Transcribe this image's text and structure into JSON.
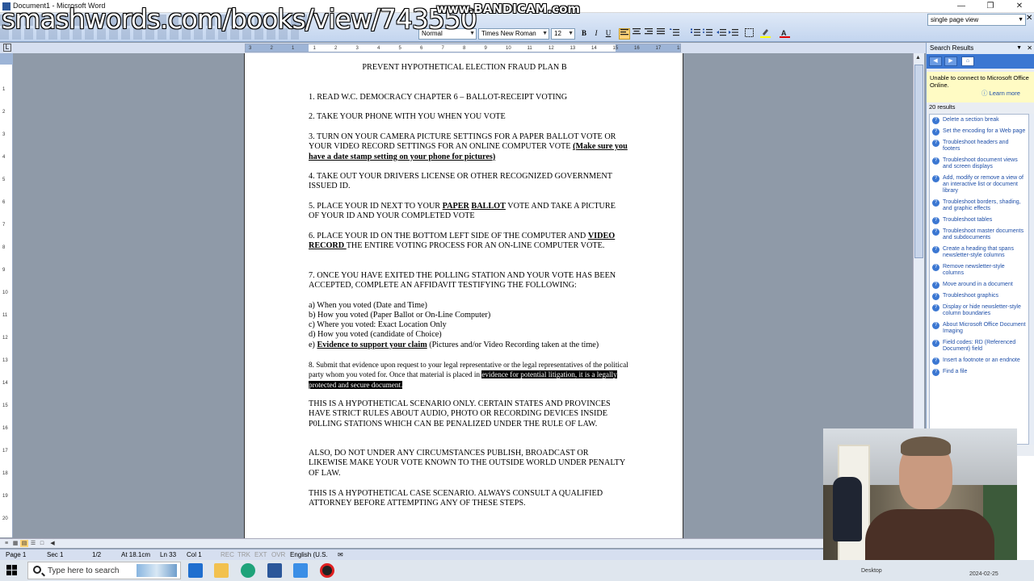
{
  "window": {
    "title": "Document1 - Microsoft Word"
  },
  "overlay": {
    "url_watermark": "smashwords.com/books/view/743550",
    "recorder": "www.BANDICAM.com"
  },
  "toolbar": {
    "style": "Normal",
    "font": "Times New Roman",
    "size": "12",
    "bold": "B",
    "italic": "I",
    "underline": "U",
    "help_box": "single page view"
  },
  "ruler": {
    "ticks": [
      "3",
      "2",
      "1",
      "1",
      "2",
      "3",
      "4",
      "5",
      "6",
      "7",
      "8",
      "9",
      "10",
      "11",
      "12",
      "13",
      "14",
      "15",
      "16",
      "17",
      "18"
    ]
  },
  "document": {
    "title": "PREVENT HYPOTHETICAL ELECTION FRAUD PLAN B",
    "p1": "1. READ W.C. DEMOCRACY CHAPTER 6 – BALLOT-RECEIPT VOTING",
    "p2": "2. TAKE YOUR PHONE WITH YOU WHEN YOU VOTE",
    "p3a": "3. TURN ON YOUR CAMERA PICTURE SETTINGS FOR A PAPER BALLOT VOTE OR YOUR VIDEO RECORD SETTINGS FOR AN ONLINE COMPUTER VOTE ",
    "p3b": "(Make sure you have a date stamp setting on your phone for pictures)",
    "p4": "4. TAKE OUT YOUR DRIVERS LICENSE OR OTHER RECOGNIZED GOVERNMENT ISSUED ID.",
    "p5a": "5. PLACE YOUR ID NEXT TO YOUR ",
    "p5b": "PAPER",
    "p5c": " ",
    "p5d": "BALLOT",
    "p5e": " VOTE AND TAKE A PICTURE OF YOUR ID AND YOUR COMPLETED VOTE",
    "p6a": "6. PLACE YOUR ID ON THE BOTTOM LEFT SIDE OF THE COMPUTER AND ",
    "p6b": "VIDEO RECORD ",
    "p6c": "THE ENTIRE VOTING PROCESS FOR AN ON-LINE COMPUTER VOTE.",
    "p7": "7. ONCE YOU HAVE EXITED THE POLLING STATION AND YOUR VOTE HAS BEEN ACCEPTED, COMPLETE AN AFFIDAVIT TESTIFYING THE FOLLOWING:",
    "la": "a) When you voted (Date and Time)",
    "lb": "b) How you voted (Paper Ballot or On-Line Computer)",
    "lc": "c) Where you voted: Exact Location Only",
    "ld": "d) How you voted (candidate of Choice)",
    "le1": "e) ",
    "le2": "Evidence to support your claim",
    "le3": " (Pictures and/or Video Recording taken at the time)",
    "p8a": "8. Submit that evidence upon request to your legal representative or the legal representatives of the political party whom you voted for. Once that material is placed in ",
    "p8b": "evidence for potential litigation, it is a legally protected and secure document.",
    "p9": "THIS IS A HYPOTHETICAL SCENARIO ONLY. CERTAIN STATES AND PROVINCES HAVE STRICT RULES ABOUT AUDIO, PHOTO OR RECORDING DEVICES INSIDE P0LLING STATIONS WHICH CAN BE PENALIZED UNDER THE RULE OF LAW.",
    "p10": "ALSO, DO NOT UNDER ANY CIRCUMSTANCES PUBLISH, BROADCAST OR LIKEWISE MAKE YOUR VOTE KNOWN TO THE OUTSIDE WORLD UNDER PENALTY OF LAW.",
    "p11": "THIS IS A HYPOTHETICAL CASE SCENARIO. ALWAYS CONSULT A QUALIFIED ATTORNEY BEFORE ATTEMPTING ANY OF THESE STEPS."
  },
  "status": {
    "page": "Page 1",
    "sec": "Sec 1",
    "pages": "1/2",
    "at": "At 18.1cm",
    "ln": "Ln 33",
    "col": "Col 1",
    "rec": "REC",
    "trk": "TRK",
    "ext": "EXT",
    "ovr": "OVR",
    "lang": "English (U.S."
  },
  "taskpane": {
    "title": "Search Results",
    "warning": "Unable to connect to Microsoft Office Online.",
    "learn_more": "Learn more",
    "count": "20 results",
    "items": [
      "Delete a section break",
      "Set the encoding for a Web page",
      "Troubleshoot headers and footers",
      "Troubleshoot document views and screen displays",
      "Add, modify or remove a view of an interactive list or document library",
      "Troubleshoot borders, shading, and graphic effects",
      "Troubleshoot tables",
      "Troubleshoot master documents and subdocuments",
      "Create a heading that spans newsletter-style columns",
      "Remove newsletter-style columns",
      "Move around in a document",
      "Troubleshoot graphics",
      "Display or hide newsletter-style column boundaries",
      "About Microsoft Office Document Imaging",
      "Field codes: RD (Referenced Document) field",
      "Insert a footnote or an endnote",
      "Find a file"
    ]
  },
  "taskbar": {
    "search_placeholder": "Type here to search",
    "date": "2024-02-25",
    "desktop": "Desktop"
  },
  "colors": {
    "accent": "#3b77d2",
    "link": "#1f4fa8",
    "warning_bg": "#fffbc4"
  }
}
